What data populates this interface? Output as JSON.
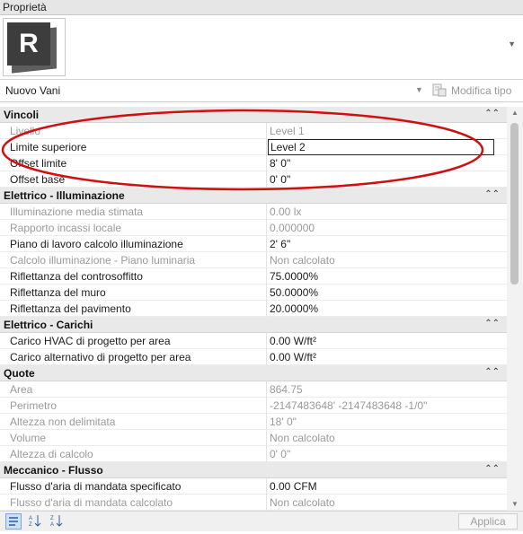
{
  "panel": {
    "title": "Proprietà"
  },
  "type_selector": {
    "value": "Nuovo Vani",
    "edit_type_label": "Modifica tipo"
  },
  "groups": [
    {
      "title": "Vincoli",
      "rows": [
        {
          "name": "Livello",
          "value": "Level 1",
          "readonly": true
        },
        {
          "name": "Limite superiore",
          "value": "Level 2",
          "readonly": false,
          "editing": true
        },
        {
          "name": "Offset limite",
          "value": "8'  0\"",
          "readonly": false
        },
        {
          "name": "Offset base",
          "value": "0'  0\"",
          "readonly": false
        }
      ]
    },
    {
      "title": "Elettrico - Illuminazione",
      "rows": [
        {
          "name": "Illuminazione media stimata",
          "value": "0.00 lx",
          "readonly": true
        },
        {
          "name": "Rapporto incassi locale",
          "value": "0.000000",
          "readonly": true
        },
        {
          "name": "Piano di lavoro calcolo illuminazione",
          "value": "2'  6\"",
          "readonly": false
        },
        {
          "name": "Calcolo illuminazione - Piano luminaria",
          "value": "Non calcolato",
          "readonly": true
        },
        {
          "name": "Riflettanza del controsoffitto",
          "value": "75.0000%",
          "readonly": false
        },
        {
          "name": "Riflettanza del muro",
          "value": "50.0000%",
          "readonly": false
        },
        {
          "name": "Riflettanza del pavimento",
          "value": "20.0000%",
          "readonly": false
        }
      ]
    },
    {
      "title": "Elettrico - Carichi",
      "rows": [
        {
          "name": "Carico HVAC di progetto per area",
          "value": "0.00 W/ft²",
          "readonly": false
        },
        {
          "name": "Carico alternativo di progetto per area",
          "value": "0.00 W/ft²",
          "readonly": false
        }
      ]
    },
    {
      "title": "Quote",
      "rows": [
        {
          "name": "Area",
          "value": "864.75",
          "readonly": true
        },
        {
          "name": "Perimetro",
          "value": "-2147483648'  -2147483648 -1/0\"",
          "readonly": true
        },
        {
          "name": "Altezza non delimitata",
          "value": "18'  0\"",
          "readonly": true
        },
        {
          "name": "Volume",
          "value": "Non calcolato",
          "readonly": true
        },
        {
          "name": "Altezza di calcolo",
          "value": "0'  0\"",
          "readonly": true
        }
      ]
    },
    {
      "title": "Meccanico - Flusso",
      "rows": [
        {
          "name": "Flusso d'aria di mandata specificato",
          "value": "0.00 CFM",
          "readonly": false
        },
        {
          "name": "Flusso d'aria di mandata calcolato",
          "value": "Non calcolato",
          "readonly": true
        }
      ]
    }
  ],
  "footer": {
    "apply_label": "Applica"
  },
  "icons": {
    "logo": "revit-logo-icon",
    "sort_category": "sort-category-icon",
    "sort_az": "sort-ascending-icon",
    "sort_za": "sort-descending-icon"
  },
  "colors": {
    "annotation": "#d01010",
    "group_bg": "#e9e9e9",
    "readonly_text": "#9a9a9a"
  }
}
